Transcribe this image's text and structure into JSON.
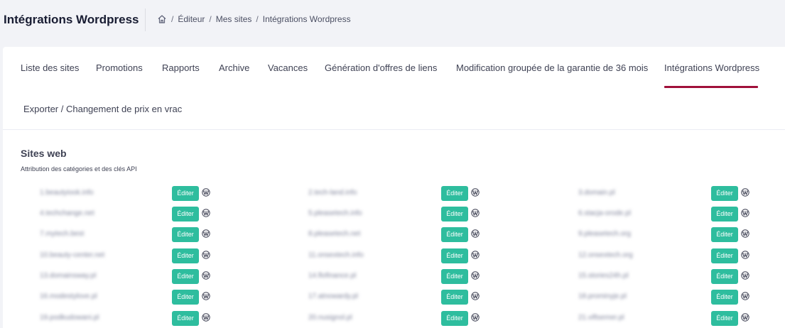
{
  "header": {
    "title": "Intégrations Wordpress",
    "breadcrumb": [
      "Éditeur",
      "Mes sites",
      "Intégrations Wordpress"
    ]
  },
  "tabs": [
    {
      "label": "Liste des sites"
    },
    {
      "label": "Promotions"
    },
    {
      "label": "Rapports"
    },
    {
      "label": "Archive"
    },
    {
      "label": "Vacances"
    },
    {
      "label": "Génération d'offres de liens"
    },
    {
      "label": "Modification groupée de la garantie de 36 mois"
    },
    {
      "label": "Intégrations Wordpress",
      "active": true
    },
    {
      "label": "Exporter / Changement de prix en vrac"
    }
  ],
  "section": {
    "title": "Sites web",
    "subtitle": "Attribution des catégories et des clés API"
  },
  "sites": [
    [
      "1.beautyiook.info",
      "2.tech-land.info",
      "3.domain.pl"
    ],
    [
      "4.techchange.net",
      "5.pleasetech.info",
      "6.stacja-orode.pl"
    ],
    [
      "7.mytech.best",
      "8.pleasetech.net",
      "9.pleasetech.org"
    ],
    [
      "10.beauty-center.net",
      "11.onsextech.info",
      "12.onsextech.org"
    ],
    [
      "13.domainsway.pl",
      "14.flofinance.pl",
      "15.stories24h.pl"
    ],
    [
      "16.modestylove.pl",
      "17.atnowardy.pl",
      "18.prominyje.pl"
    ],
    [
      "19.podkudowani.pl",
      "20.nusignol.pl",
      "21.viftsemer.pl"
    ]
  ],
  "edit_label": "Éditer",
  "icons": {
    "home": "home-icon",
    "wordpress": "wordpress-icon"
  },
  "colors": {
    "accent_button": "#2ebd9e",
    "active_tab_underline": "#a0103a"
  }
}
